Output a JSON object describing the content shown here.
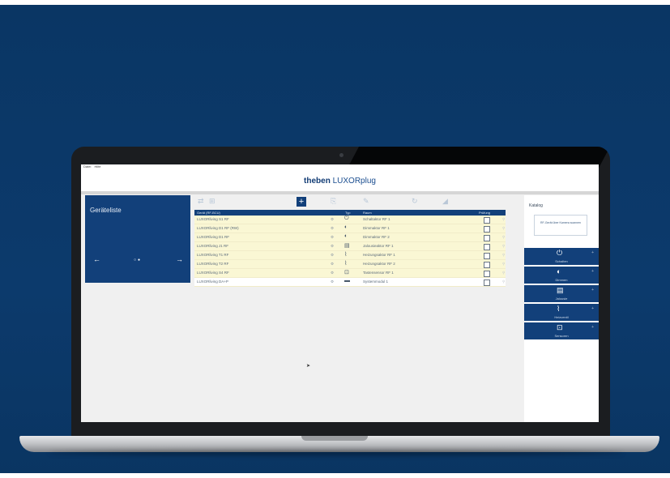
{
  "menu": [
    "Datei",
    "Hilfe"
  ],
  "brand": {
    "name": "theben",
    "product": "LUXORplug"
  },
  "left_panel": {
    "title": "Geräteliste",
    "prev": "←",
    "next": "→",
    "dots": "○●"
  },
  "table": {
    "headers": [
      "Gerät (RF-BCU)",
      "Typ",
      "Raum",
      "Prüfung"
    ],
    "rows": [
      {
        "name": "LUXORliving S1 RF",
        "icon": "⏻",
        "room": "Schaltaktor RF 1",
        "highlight": true
      },
      {
        "name": "LUXORliving D1 RF (RW)",
        "icon": "◐",
        "room": "Dimmaktor RF 1",
        "highlight": true
      },
      {
        "name": "LUXORliving D1 RF",
        "icon": "◐",
        "room": "Dimmaktor RF 2",
        "highlight": true
      },
      {
        "name": "LUXORliving J1 RF",
        "icon": "▤",
        "room": "Jalousieaktor RF 1",
        "highlight": true
      },
      {
        "name": "LUXORliving T1 RF",
        "icon": "⌇",
        "room": "Heizungsaktor RF 1",
        "highlight": true
      },
      {
        "name": "LUXORliving T2 RF",
        "icon": "⌇",
        "room": "Heizungsaktor RF 2",
        "highlight": true
      },
      {
        "name": "LUXORliving S4 RF",
        "icon": "⊡",
        "room": "Tastensensor RF 1",
        "highlight": true
      },
      {
        "name": "LUXORliving DA+P",
        "icon": "▬",
        "room": "Systemmodul 1",
        "highlight": false
      }
    ]
  },
  "catalog": {
    "title": "Katalog",
    "hint": "RF-Gerät über Kamera scannen",
    "items": [
      {
        "label": "Schalten",
        "icon": "⏻"
      },
      {
        "label": "Dimmen",
        "icon": "◐"
      },
      {
        "label": "Jalousie",
        "icon": "▤"
      },
      {
        "label": "Heizventil",
        "icon": "⌇"
      },
      {
        "label": "Sensoren",
        "icon": "⊡"
      }
    ]
  },
  "colors": {
    "primary": "#12407a",
    "row_highlight": "#faf7d4",
    "background": "#0c3a6c"
  }
}
